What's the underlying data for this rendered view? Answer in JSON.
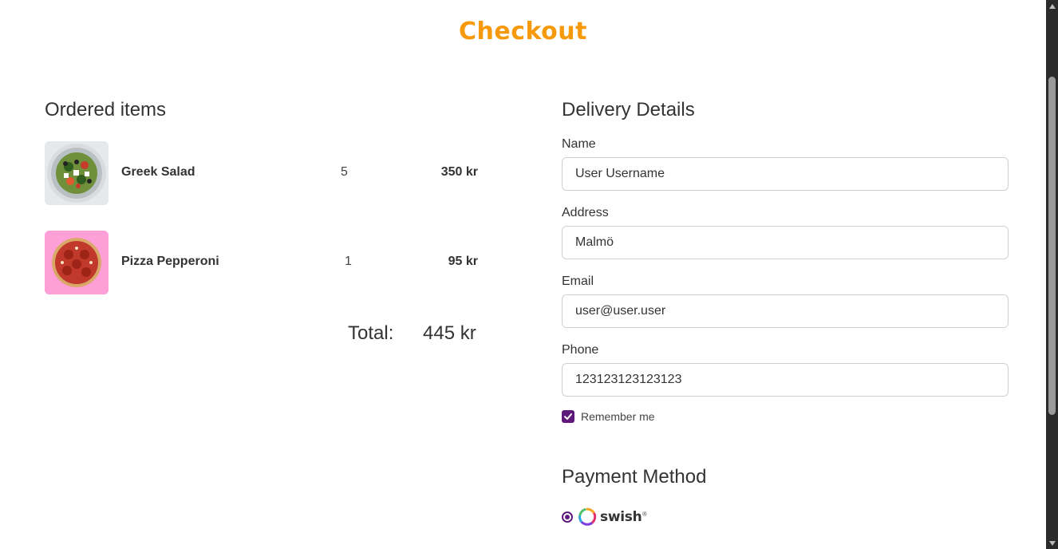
{
  "page_title": "Checkout",
  "order": {
    "heading": "Ordered items",
    "items": [
      {
        "name": "Greek Salad",
        "quantity": "5",
        "price": "350 kr",
        "image_icon": "greek-salad-photo"
      },
      {
        "name": "Pizza Pepperoni",
        "quantity": "1",
        "price": "95 kr",
        "image_icon": "pizza-pepperoni-photo"
      }
    ],
    "total_label": "Total:",
    "total_value": "445 kr"
  },
  "delivery": {
    "heading": "Delivery Details",
    "name_label": "Name",
    "name_value": "User Username",
    "address_label": "Address",
    "address_value": "Malmö",
    "email_label": "Email",
    "email_value": "user@user.user",
    "phone_label": "Phone",
    "phone_value": "123123123123123",
    "remember_label": "Remember me",
    "remember_checked": true
  },
  "payment": {
    "heading": "Payment Method",
    "option_name": "swish",
    "option_selected": true
  },
  "colors": {
    "brand_orange": "#f7990c",
    "accent_purple": "#5e1a7a",
    "pizza_bg": "#ff9fd8"
  }
}
